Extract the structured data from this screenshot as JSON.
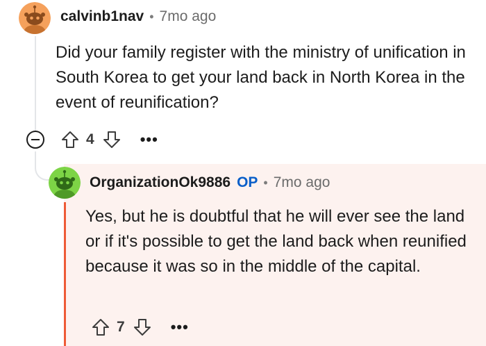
{
  "comment": {
    "author": "calvinb1nav",
    "separator": "•",
    "time": "7mo ago",
    "body": "Did your family register with the ministry of unification in South Korea to get your land back in North Korea in the event of reunification?",
    "votes": "4",
    "more": "•••",
    "avatar_color": "#f5a15c"
  },
  "reply": {
    "author": "OrganizationOk9886",
    "op_label": "OP",
    "separator": "•",
    "time": "7mo ago",
    "body": "Yes, but he is doubtful that he will ever see the land or if it's possible to get the land back when reunified because it was so in the middle of the capital.",
    "votes": "7",
    "more": "•••",
    "avatar_color": "#7dd446",
    "highlight_color": "#ee5a36",
    "background_color": "#fdf2ef"
  },
  "icons": {
    "collapse": "collapse-minus-icon",
    "upvote": "upvote-arrow-icon",
    "downvote": "downvote-arrow-icon"
  }
}
